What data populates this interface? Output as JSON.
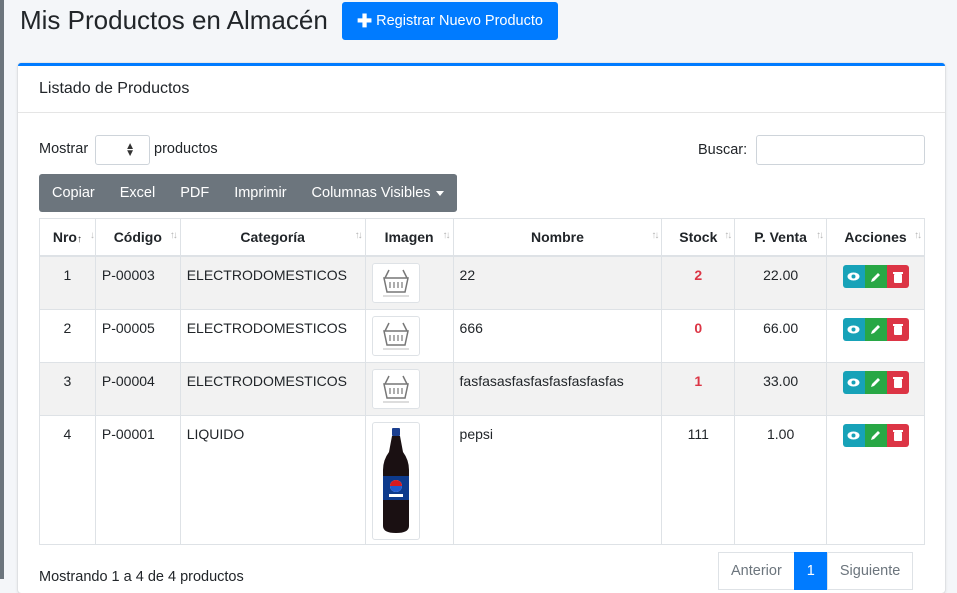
{
  "page": {
    "title": "Mis Productos en Almacén",
    "new_button": "Registrar Nuevo Producto"
  },
  "card": {
    "header": "Listado de Productos"
  },
  "controls": {
    "show_label": "Mostrar",
    "show_suffix": "productos",
    "search_label": "Buscar:",
    "search_value": "",
    "length_value": ""
  },
  "buttons": [
    "Copiar",
    "Excel",
    "PDF",
    "Imprimir",
    "Columnas Visibles"
  ],
  "table": {
    "headers": [
      "Nro",
      "Código",
      "Categoría",
      "Imagen",
      "Nombre",
      "Stock",
      "P. Venta",
      "Acciones"
    ],
    "rows": [
      {
        "nro": "1",
        "codigo": "P-00003",
        "categoria": "ELECTRODOMESTICOS",
        "imagen": "no-image-placeholder",
        "nombre": "22",
        "stock": "2",
        "precio": "22.00"
      },
      {
        "nro": "2",
        "codigo": "P-00005",
        "categoria": "ELECTRODOMESTICOS",
        "imagen": "no-image-placeholder",
        "nombre": "666",
        "stock": "0",
        "precio": "66.00"
      },
      {
        "nro": "3",
        "codigo": "P-00004",
        "categoria": "ELECTRODOMESTICOS",
        "imagen": "no-image-placeholder",
        "nombre": "fasfasasfasfasfasfasfasfas",
        "stock": "1",
        "precio": "33.00"
      },
      {
        "nro": "4",
        "codigo": "P-00001",
        "categoria": "LIQUIDO",
        "imagen": "pepsi-bottle",
        "nombre": "pepsi",
        "stock": "111",
        "precio": "1.00"
      }
    ]
  },
  "footer": {
    "info": "Mostrando 1 a 4 de 4 productos",
    "prev": "Anterior",
    "page": "1",
    "next": "Siguiente"
  },
  "colors": {
    "primary": "#007bff",
    "info": "#17a2b8",
    "success": "#28a745",
    "danger": "#dc3545",
    "secondary": "#6c757d"
  }
}
